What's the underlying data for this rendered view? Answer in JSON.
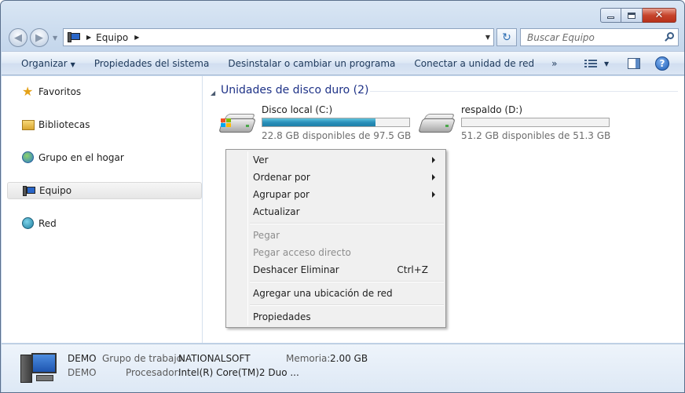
{
  "window": {
    "caption": {
      "minimize": "",
      "maximize": "",
      "close": "✕"
    }
  },
  "address": {
    "location": "Equipo",
    "search_placeholder": "Buscar Equipo"
  },
  "commandbar": {
    "organize": "Organizar",
    "system_properties": "Propiedades del sistema",
    "uninstall": "Desinstalar o cambiar un programa",
    "map_drive": "Conectar a unidad de red",
    "more": "»"
  },
  "navpane": {
    "items": [
      {
        "label": "Favoritos",
        "icon": "star-icon"
      },
      {
        "label": "Bibliotecas",
        "icon": "libraries-icon"
      },
      {
        "label": "Grupo en el hogar",
        "icon": "homegroup-icon"
      },
      {
        "label": "Equipo",
        "icon": "computer-icon",
        "selected": true
      },
      {
        "label": "Red",
        "icon": "network-icon"
      }
    ]
  },
  "main": {
    "group_title": "Unidades de disco duro (2)",
    "drives": [
      {
        "name": "Disco local (C:)",
        "free_text": "22.8 GB disponibles de 97.5 GB",
        "used_fraction": 0.77
      },
      {
        "name": "respaldo (D:)",
        "free_text": "51.2 GB disponibles de 51.3 GB",
        "used_fraction": 0.0
      }
    ]
  },
  "context_menu": {
    "items": [
      {
        "label": "Ver",
        "submenu": true
      },
      {
        "label": "Ordenar por",
        "submenu": true
      },
      {
        "label": "Agrupar por",
        "submenu": true
      },
      {
        "label": "Actualizar"
      },
      {
        "label": "Pegar",
        "disabled": true
      },
      {
        "label": "Pegar acceso directo",
        "disabled": true
      },
      {
        "label": "Deshacer Eliminar",
        "shortcut": "Ctrl+Z"
      },
      {
        "label": "Agregar una ubicación de red"
      },
      {
        "label": "Propiedades"
      }
    ]
  },
  "details": {
    "name": "DEMO",
    "name2": "DEMO",
    "workgroup_label": "Grupo de trabajo:",
    "workgroup_value": "NATIONALSOFT",
    "memory_label": "Memoria:",
    "memory_value": "2.00 GB",
    "processor_label": "Procesador:",
    "processor_value": "Intel(R) Core(TM)2 Duo ..."
  },
  "colors": {
    "accent": "#1e3287",
    "drive_bar": "#2a8fb9",
    "close_button": "#c7452c"
  }
}
